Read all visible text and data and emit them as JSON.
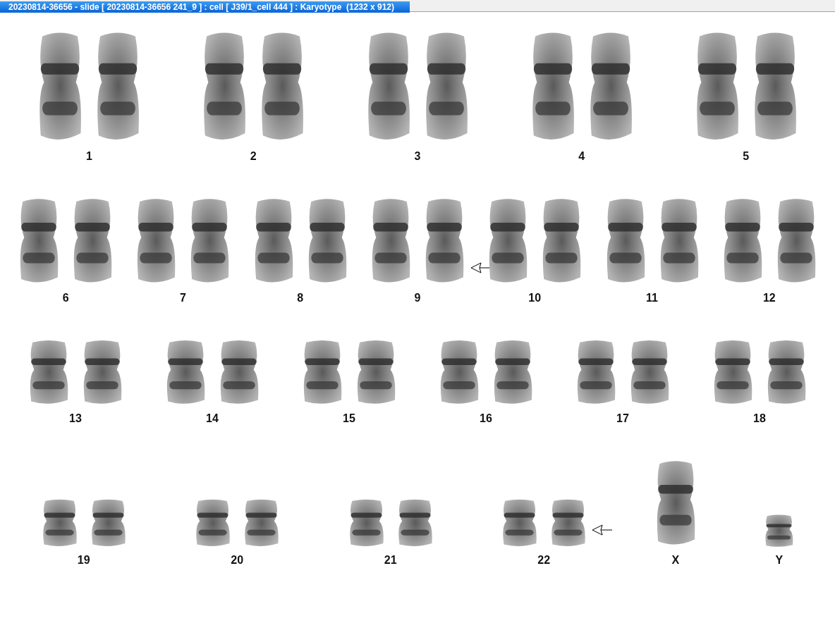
{
  "window": {
    "title": "20230814-36656 - slide [ 20230814-36656 241_9 ] : cell [ J39/1_cell 444 ] : Karyotype  (1232 x 912)"
  },
  "rows": [
    {
      "pairs": [
        {
          "label": "1",
          "kind": "pair",
          "marked": false
        },
        {
          "label": "2",
          "kind": "pair",
          "marked": false
        },
        {
          "label": "3",
          "kind": "pair",
          "marked": false
        },
        {
          "label": "4",
          "kind": "pair",
          "marked": false
        },
        {
          "label": "5",
          "kind": "pair",
          "marked": false
        }
      ]
    },
    {
      "pairs": [
        {
          "label": "6",
          "kind": "pair",
          "marked": false
        },
        {
          "label": "7",
          "kind": "pair",
          "marked": false
        },
        {
          "label": "8",
          "kind": "pair",
          "marked": false
        },
        {
          "label": "9",
          "kind": "pair",
          "marked": true
        },
        {
          "label": "10",
          "kind": "pair",
          "marked": false
        },
        {
          "label": "11",
          "kind": "pair",
          "marked": false
        },
        {
          "label": "12",
          "kind": "pair",
          "marked": false
        }
      ]
    },
    {
      "pairs": [
        {
          "label": "13",
          "kind": "pair",
          "marked": false
        },
        {
          "label": "14",
          "kind": "pair",
          "marked": false
        },
        {
          "label": "15",
          "kind": "pair",
          "marked": false
        },
        {
          "label": "16",
          "kind": "pair",
          "marked": false
        },
        {
          "label": "17",
          "kind": "pair",
          "marked": false
        },
        {
          "label": "18",
          "kind": "pair",
          "marked": false
        }
      ]
    },
    {
      "pairs": [
        {
          "label": "19",
          "kind": "pair",
          "marked": false
        },
        {
          "label": "20",
          "kind": "pair",
          "marked": false
        },
        {
          "label": "21",
          "kind": "pair",
          "marked": false
        },
        {
          "label": "22",
          "kind": "pair",
          "marked": true
        },
        {
          "label": "X",
          "kind": "large",
          "marked": false
        },
        {
          "label": "Y",
          "kind": "small",
          "marked": false
        }
      ]
    }
  ]
}
